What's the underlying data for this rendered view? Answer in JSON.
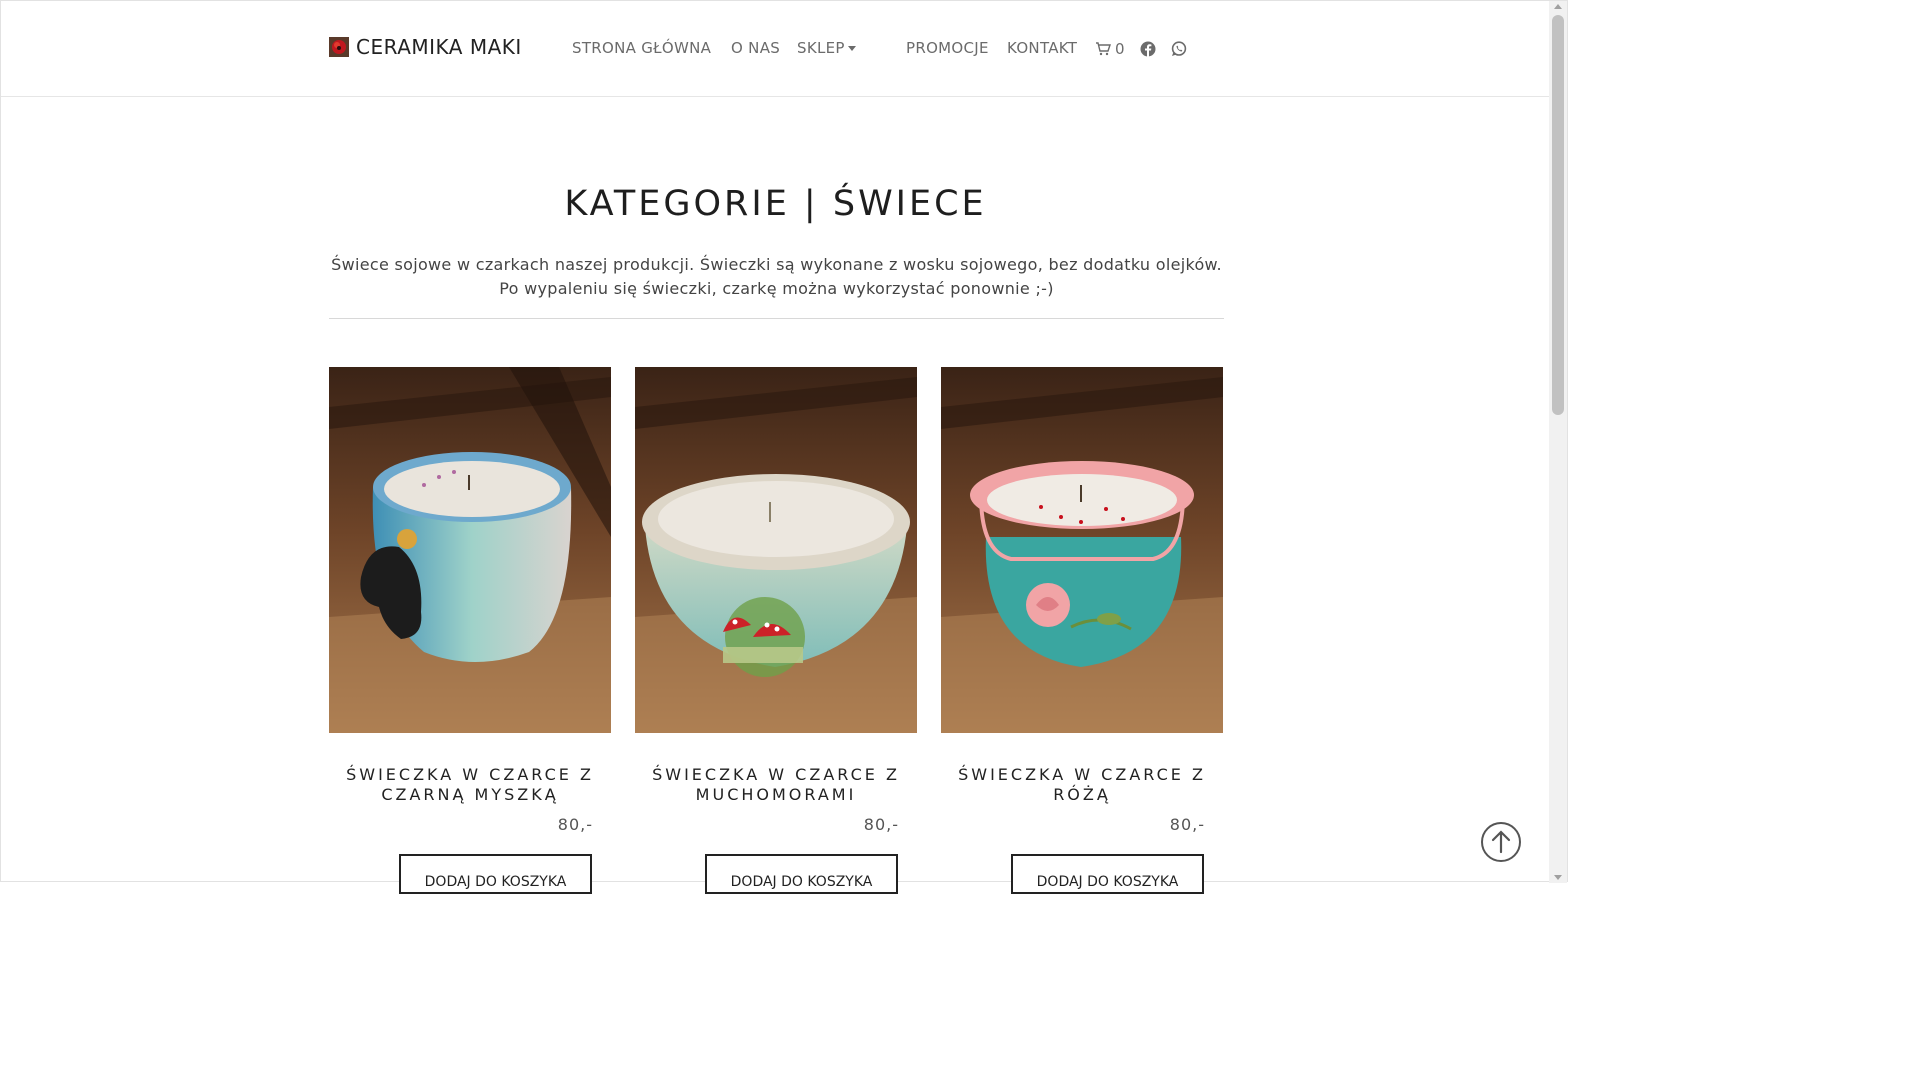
{
  "header": {
    "brand": "CERAMIKA MAKI",
    "nav": [
      {
        "label": "STRONA GŁÓWNA"
      },
      {
        "label": "O NAS"
      },
      {
        "label": "SKLEP"
      },
      {
        "label": "PROMOCJE"
      },
      {
        "label": "KONTAKT"
      }
    ],
    "cart_count": "0",
    "icons": [
      "cart-icon",
      "facebook-icon",
      "whatsapp-icon"
    ]
  },
  "page": {
    "title": "KATEGORIE | ŚWIECE",
    "description_line1": "Świece sojowe w czarkach naszej produkcji. Świeczki są wykonane z wosku sojowego, bez dodatku olejków.",
    "description_line2": "Po wypaleniu się świeczki, czarkę można wykorzystać ponownie ;-)"
  },
  "products": [
    {
      "name": "ŚWIECZKA W CZARCE Z CZARNĄ MYSZKĄ",
      "price": "80,-",
      "button": "DODAJ DO KOSZYKA"
    },
    {
      "name": "ŚWIECZKA W CZARCE Z MUCHOMORAMI",
      "price": "80,-",
      "button": "DODAJ DO KOSZYKA"
    },
    {
      "name": "ŚWIECZKA W CZARCE Z RÓŻĄ",
      "price": "80,-",
      "button": "DODAJ DO KOSZYKA"
    }
  ],
  "colors": {
    "text_dark": "#1e1e1e",
    "nav_text": "#6b6b6b",
    "wood": "#6b3f22"
  }
}
